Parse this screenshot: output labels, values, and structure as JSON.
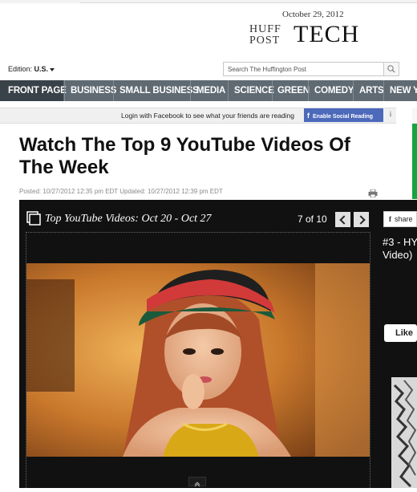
{
  "header": {
    "date": "October 29, 2012",
    "logo_huff": "HUFF",
    "logo_post": "POST",
    "section": "TECH",
    "edition_label": "Edition:",
    "edition_value": "U.S.",
    "search_placeholder": "Search The Huffington Post"
  },
  "nav": {
    "items": [
      {
        "label": "FRONT PAGE"
      },
      {
        "label": "BUSINESS"
      },
      {
        "label": "SMALL BUSINESS"
      },
      {
        "label": "MEDIA"
      },
      {
        "label": "SCIENCE"
      },
      {
        "label": "GREEN"
      },
      {
        "label": "COMEDY"
      },
      {
        "label": "ARTS"
      },
      {
        "label": "NEW Y"
      }
    ]
  },
  "social": {
    "prompt": "Login with Facebook to see what your friends are reading",
    "button": "Enable Social Reading",
    "fb_glyph": "f",
    "info": "i"
  },
  "article": {
    "headline": "Watch The Top 9 YouTube Videos Of The Week",
    "posted": "Posted: 10/27/2012 12:35 pm EDT Updated: 10/27/2012 12:39 pm EDT"
  },
  "slideshow": {
    "title": "Top YouTube Videos: Oct 20 - Oct 27",
    "counter": "7 of 10",
    "current_slide": 7,
    "total_slides": 10,
    "share_label": "share",
    "caption": "#3 - HY",
    "caption_line2": "Video)",
    "like_label": "Like"
  },
  "colors": {
    "nav_bg": "#5f6a73",
    "nav_active": "#3a4249",
    "facebook": "#4c69ba",
    "slideshow_bg": "#111111",
    "accent_green": "#16a43f"
  },
  "icons": {
    "search": "search-icon",
    "print": "print-icon",
    "prev": "chevron-left-icon",
    "next": "chevron-right-icon",
    "gallery": "gallery-icon",
    "collapse": "chevron-up-icon"
  }
}
